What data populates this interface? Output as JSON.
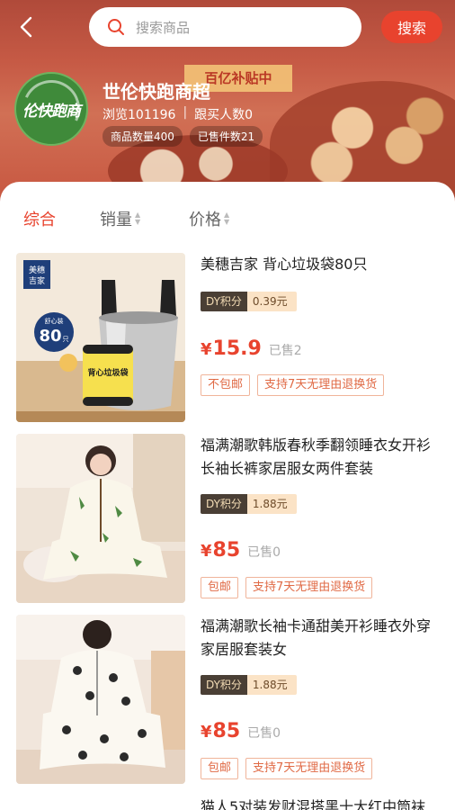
{
  "search": {
    "placeholder": "搜索商品",
    "button": "搜索"
  },
  "shop": {
    "logo_text": "伦快跑商",
    "name": "世伦快跑商超",
    "views": "浏览101196",
    "followers": "跟买人数0",
    "tags": [
      "商品数量400",
      "已售件数21"
    ],
    "banner_text": "百亿补贴中"
  },
  "sort": {
    "items": [
      "综合",
      "销量",
      "价格"
    ]
  },
  "products": [
    {
      "title": "美穗吉家 背心垃圾袋80只",
      "dy_label": "DY积分",
      "dy_value": "0.39元",
      "currency": "¥",
      "price": "15.9",
      "sold": "已售2",
      "tags": [
        "不包邮",
        "支持7天无理由退换货"
      ],
      "img": {
        "brand": "美穗\n吉家",
        "badge_top": "舒心装",
        "badge_num": "80",
        "badge_unit": "只",
        "can_label": "背心垃圾袋"
      }
    },
    {
      "title": "福满潮歌韩版春秋季翻领睡衣女开衫长袖长裤家居服女两件套装",
      "dy_label": "DY积分",
      "dy_value": "1.88元",
      "currency": "¥",
      "price": "85",
      "sold": "已售0",
      "tags": [
        "包邮",
        "支持7天无理由退换货"
      ]
    },
    {
      "title": "福满潮歌长袖卡通甜美开衫睡衣外穿家居服套装女",
      "dy_label": "DY积分",
      "dy_value": "1.88元",
      "currency": "¥",
      "price": "85",
      "sold": "已售0",
      "tags": [
        "包邮",
        "支持7天无理由退换货"
      ]
    },
    {
      "title": "猫人5对装发财混搭黑十大红中筒袜"
    }
  ]
}
